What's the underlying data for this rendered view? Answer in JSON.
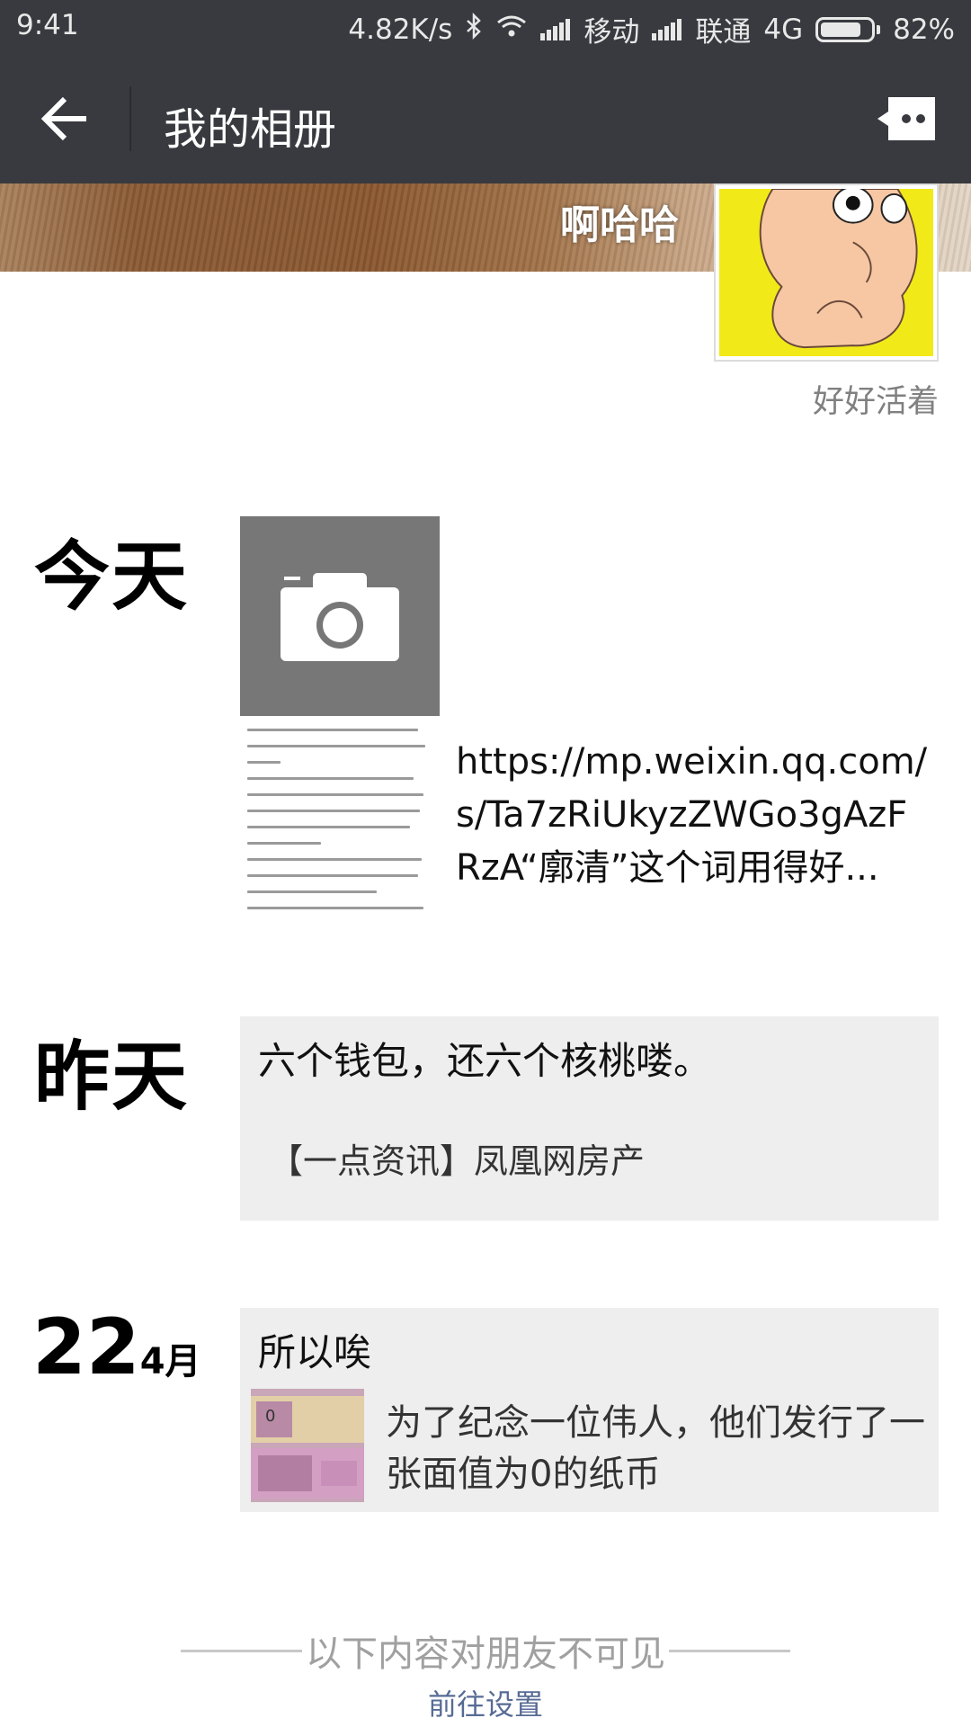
{
  "status_bar": {
    "time": "9:41",
    "net_speed": "4.82K/s",
    "carrier1": "移动",
    "carrier2": "联通",
    "network": "4G",
    "battery_percent": "82%",
    "battery_level": 0.82,
    "icons": [
      "bluetooth-icon",
      "wifi-icon",
      "signal-icon",
      "battery-icon"
    ]
  },
  "header": {
    "title": "我的相册",
    "back_icon": "arrow-left-icon",
    "message_icon": "chat-bubble-icon"
  },
  "profile": {
    "nickname": "啊哈哈",
    "signature": "好好活着"
  },
  "timeline": {
    "today": {
      "label": "今天",
      "camera_icon": "camera-icon",
      "link_text": "https://mp.weixin.qq.com/s/Ta7zRiUkyzZWGo3gAzFRzA“廓清”这个词用得好..."
    },
    "yesterday": {
      "label": "昨天",
      "text": "六个钱包，还六个核桃喽。",
      "source": "【一点资讯】凤凰网房产"
    },
    "apr22": {
      "day": "22",
      "month": "4月",
      "text": "所以唉",
      "share_text": "为了纪念一位伟人，他们发行了一张面值为0的纸币"
    }
  },
  "footer": {
    "hidden_note": "以下内容对朋友不可见",
    "settings_link": "前往设置"
  },
  "colors": {
    "header_bg": "#393a3f",
    "card_bg": "#eeeeee",
    "link": "#576b95"
  }
}
